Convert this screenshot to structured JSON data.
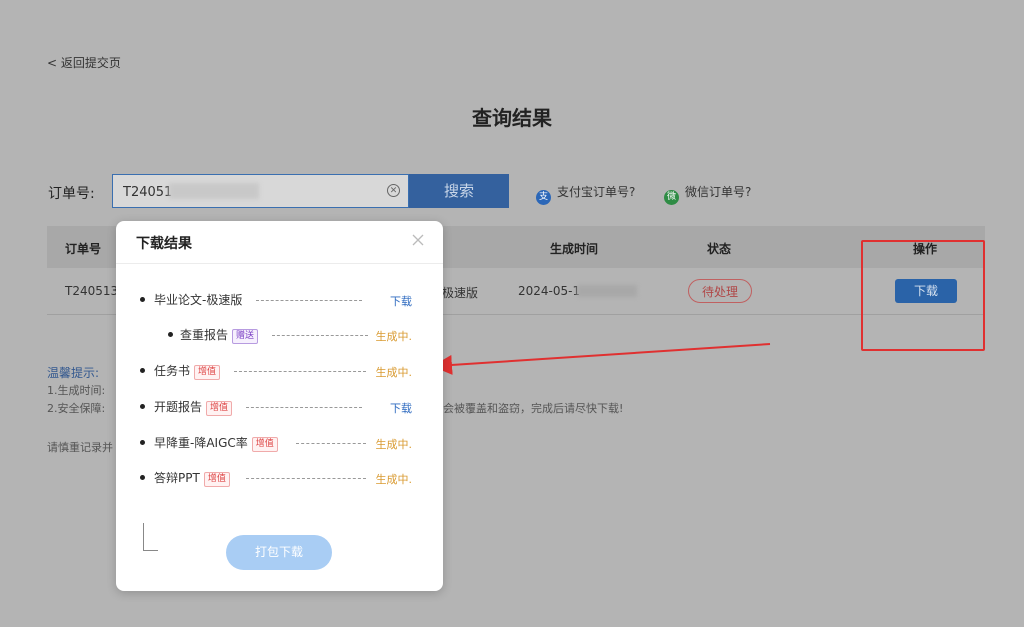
{
  "nav": {
    "back_label": "< 返回提交页"
  },
  "page": {
    "title": "查询结果"
  },
  "search": {
    "label": "订单号:",
    "value": "T24051",
    "button_label": "搜索",
    "alipay_help": "支付宝订单号?",
    "wechat_help": "微信订单号?"
  },
  "table": {
    "headers": {
      "order_no": "订单号",
      "created": "生成时间",
      "status": "状态",
      "action": "操作"
    },
    "row": {
      "order_no": "T240513",
      "version": "极速版",
      "created": "2024-05-1",
      "status": "待处理",
      "action": "下载"
    }
  },
  "tips": {
    "title": "温馨提示:",
    "line1": "1.生成时间:",
    "line2": "2.安全保障:",
    "line2_tail": "不会被覆盖和盗窃，完成后请尽快下载!",
    "note": "请慎重记录并"
  },
  "modal": {
    "title": "下载结果",
    "close_icon": "close-icon",
    "items": [
      {
        "name": "毕业论文-极速版",
        "tag": "",
        "action": "下载",
        "kind": "download"
      },
      {
        "name": "查重报告",
        "tag": "赠送",
        "action": "生成中.",
        "kind": "generating"
      },
      {
        "name": "任务书",
        "tag": "增值",
        "action": "生成中.",
        "kind": "generating"
      },
      {
        "name": "开题报告",
        "tag": "增值",
        "action": "下载",
        "kind": "download"
      },
      {
        "name": "早降重-降AIGC率",
        "tag": "增值",
        "action": "生成中.",
        "kind": "generating"
      },
      {
        "name": "答辩PPT",
        "tag": "增值",
        "action": "生成中.",
        "kind": "generating"
      }
    ],
    "pack_button": "打包下载"
  },
  "colors": {
    "primary": "#2a63a8",
    "highlight_red": "#e03030",
    "generating": "#d99a30",
    "download_link": "#2f6bc0"
  }
}
